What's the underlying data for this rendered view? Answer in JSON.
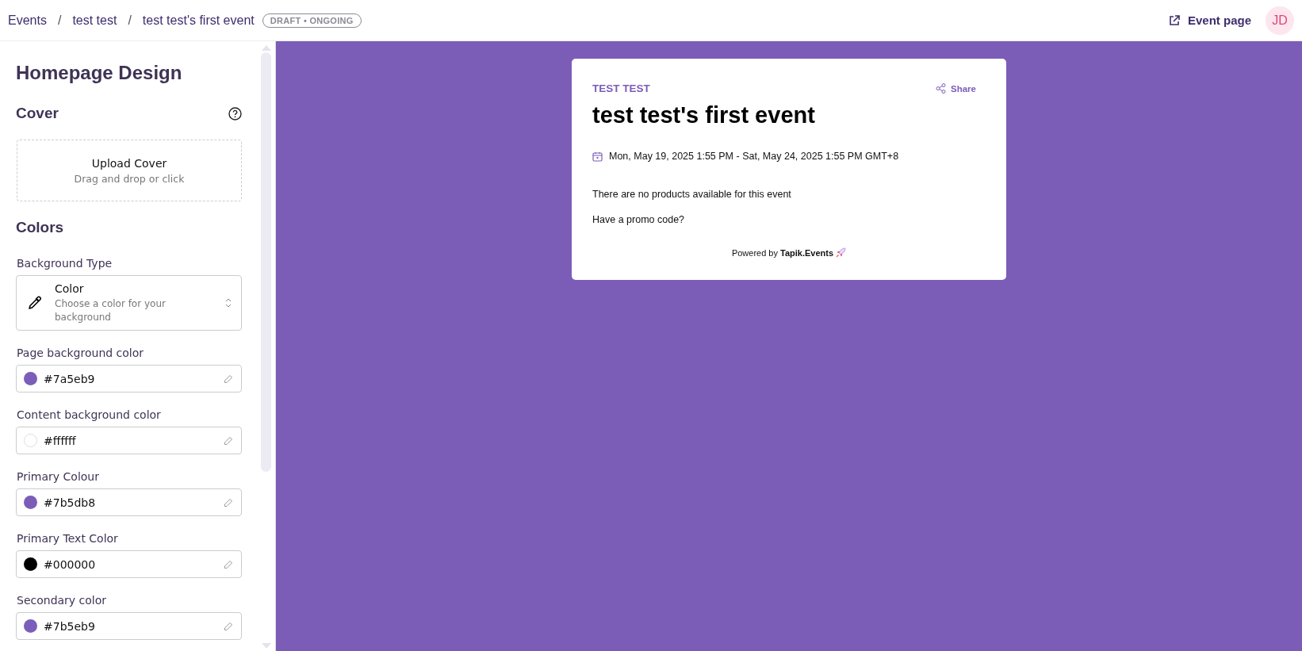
{
  "breadcrumb": [
    "Events",
    "test test",
    "test test's first event"
  ],
  "breadcrumb_separator": "/",
  "status_badge": "DRAFT • ONGOING",
  "event_page_link": "Event page",
  "avatar": "JD",
  "sidebar": {
    "title": "Homepage Design",
    "cover": {
      "heading": "Cover",
      "upload_title": "Upload Cover",
      "upload_hint": "Drag and drop or click"
    },
    "colors": {
      "heading": "Colors",
      "background_type": {
        "label": "Background Type",
        "value": "Color",
        "description": "Choose a color for your background"
      },
      "fields": [
        {
          "label": "Page background color",
          "value": "#7a5eb9",
          "color": "#7a5eb9"
        },
        {
          "label": "Content background color",
          "value": "#ffffff",
          "color": "#ffffff"
        },
        {
          "label": "Primary Colour",
          "value": "#7b5db8",
          "color": "#7b5db8"
        },
        {
          "label": "Primary Text Color",
          "value": "#000000",
          "color": "#000000"
        },
        {
          "label": "Secondary color",
          "value": "#7b5eb9",
          "color": "#7b5eb9"
        }
      ]
    }
  },
  "preview": {
    "organizer": "TEST TEST",
    "share": "Share",
    "title": "test test's first event",
    "date": "Mon, May 19, 2025 1:55 PM - Sat, May 24, 2025 1:55 PM GMT+8",
    "no_products": "There are no products available for this event",
    "promo": "Have a promo code?",
    "powered_by": "Powered by **Tapik.Events**"
  }
}
